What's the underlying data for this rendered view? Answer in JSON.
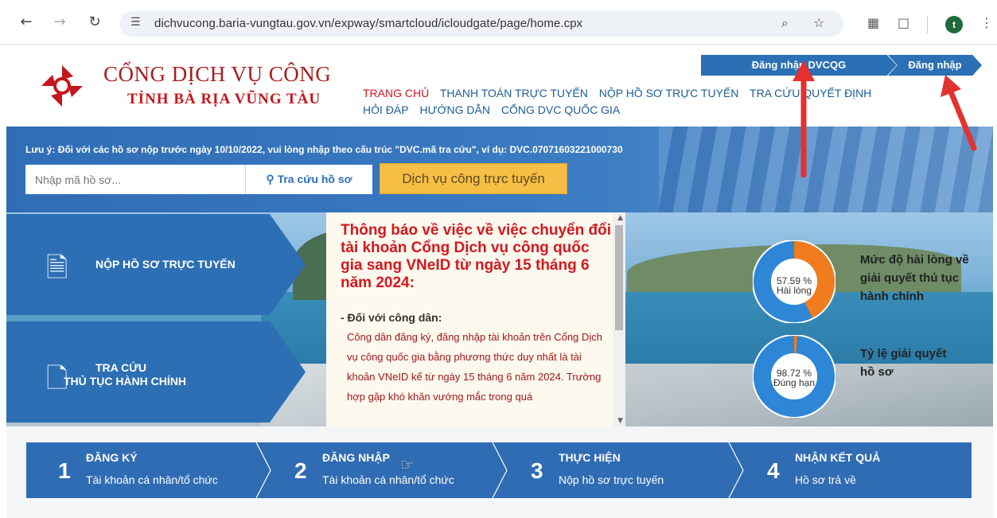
{
  "browser": {
    "url": "dichvucong.baria-vungtau.gov.vn/expway/smartcloud/icloudgate/page/home.cpx",
    "profile_initial": "t"
  },
  "header": {
    "brand_line1": "CỔNG DỊCH VỤ CÔNG",
    "brand_line2": "TỈNH BÀ RỊA VŨNG TÀU",
    "login_dvcqg": "Đăng nhập DVCQG",
    "login": "Đăng nhập",
    "menu": [
      {
        "label": "TRANG CHỦ",
        "active": true
      },
      {
        "label": "THANH TOÁN TRỰC TUYẾN"
      },
      {
        "label": "NỘP HỒ SƠ TRỰC TUYẾN"
      },
      {
        "label": "TRA CỨU QUYẾT ĐỊNH"
      },
      {
        "label": "HỎI ĐÁP"
      },
      {
        "label": "HƯỚNG DẪN"
      },
      {
        "label": "CỔNG DVC QUỐC GIA"
      }
    ]
  },
  "search": {
    "notice": "Lưu ý: Đối với các hồ sơ nộp trước ngày 10/10/2022, vui lòng nhập theo cấu trúc \"DVC.mã tra cứu\", ví dụ: DVC.07071603221000730",
    "placeholder": "Nhập mã hồ sơ...",
    "search_button": "Tra cứu hồ sơ",
    "online_service_button": "Dịch vụ công trực tuyến"
  },
  "tiles": {
    "submit": "NỘP HỒ SƠ TRỰC TUYẾN",
    "lookup_line1": "TRA CỨU",
    "lookup_line2": "THỦ TỤC HÀNH CHÍNH"
  },
  "news": {
    "title": "Thông báo về việc về việc chuyển đổi tài khoản Cổng Dịch vụ công quốc gia sang VNeID từ ngày 15 tháng 6 năm 2024:",
    "subtitle": "- Đối với công dân:",
    "body": "Công dân đăng ký, đăng nhập tài khoản trên Cổng Dịch vụ công quốc gia bằng phương thức duy nhất là tài khoản VNeID kể từ ngày 15 tháng 6 năm 2024. Trường hợp gặp khó khăn vướng mắc trong quá"
  },
  "stats": [
    {
      "percent": "57.59 %",
      "caption": "Hài lòng",
      "value": 57.59,
      "color": "#f07c1e",
      "label": "Mức độ hài lòng về giải quyết thủ tục hành chính"
    },
    {
      "percent": "98.72 %",
      "caption": "Đúng hạn",
      "value": 98.72,
      "color": "#f07c1e",
      "label": "Tỷ lệ giải quyết hồ sơ"
    }
  ],
  "steps": [
    {
      "num": "1",
      "title": "ĐĂNG KÝ",
      "desc": "Tài khoản cá nhân/tổ chức"
    },
    {
      "num": "2",
      "title": "ĐĂNG NHẬP",
      "desc": "Tài khoản cá nhân/tổ chức"
    },
    {
      "num": "3",
      "title": "THỰC HIỆN",
      "desc": "Nộp hồ sơ trực tuyến"
    },
    {
      "num": "4",
      "title": "NHẬN KẾT QUẢ",
      "desc": "Hồ sơ trả về"
    }
  ],
  "colors": {
    "primary": "#2b6fb5",
    "accent": "#f7be46",
    "red": "#d3181f",
    "ring": "#2e86d6"
  }
}
